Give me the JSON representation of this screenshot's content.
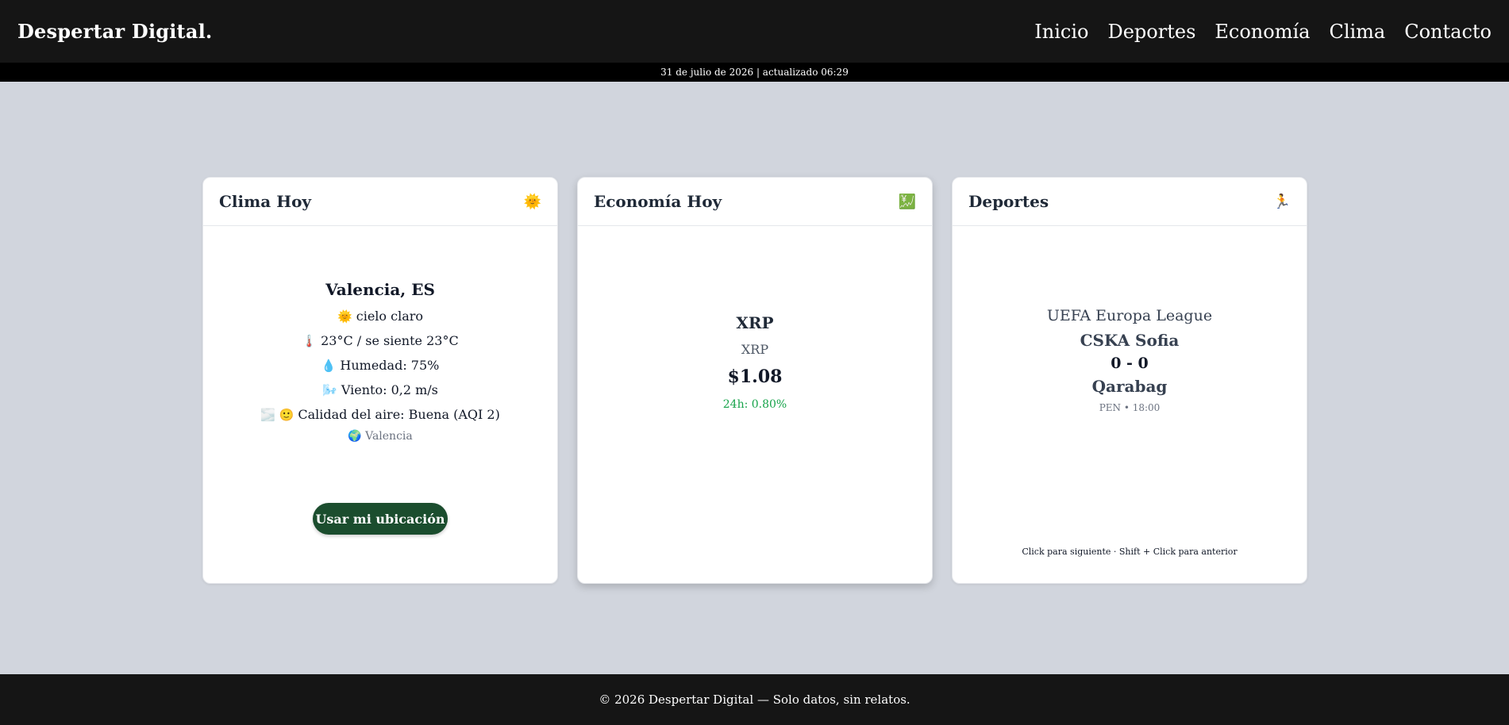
{
  "header": {
    "brand": "Despertar Digital.",
    "nav": [
      "Inicio",
      "Deportes",
      "Economía",
      "Clima",
      "Contacto"
    ]
  },
  "datebar": {
    "text": "31 de julio de 2026 | actualizado 06:29"
  },
  "weather": {
    "title": "Clima Hoy",
    "icon": "🌞",
    "city": "Valencia, ES",
    "condition_icon": "🌞",
    "condition": "cielo claro",
    "temp_icon": "🌡️",
    "temp": "23°C / se siente 23°C",
    "humidity_icon": "💧",
    "humidity": "Humedad: 75%",
    "wind_icon": "🌬️",
    "wind": "Viento: 0,2 m/s",
    "air_icon": "🌫️ 🙂",
    "air": "Calidad del aire: Buena (AQI 2)",
    "location_icon": "🌍",
    "location": "Valencia",
    "button": "Usar mi ubicación"
  },
  "economy": {
    "title": "Economía Hoy",
    "icon": "💹",
    "symbol": "XRP",
    "name": "XRP",
    "price": "$1.08",
    "change": "24h: 0.80%",
    "change_color": "#16a34a"
  },
  "sports": {
    "title": "Deportes",
    "icon": "🏃",
    "league": "UEFA Europa League",
    "home": "CSKA Sofia",
    "score": "0 - 0",
    "away": "Qarabag",
    "status": "PEN • 18:00",
    "hint": "Click para siguiente · Shift + Click para anterior"
  },
  "footer": {
    "text": "© 2026 Despertar Digital — Solo datos, sin relatos."
  },
  "colors": {
    "header_bg": "#151515",
    "page_bg": "#d1d5dd",
    "button_bg": "#1b4d2e",
    "positive": "#16a34a"
  }
}
